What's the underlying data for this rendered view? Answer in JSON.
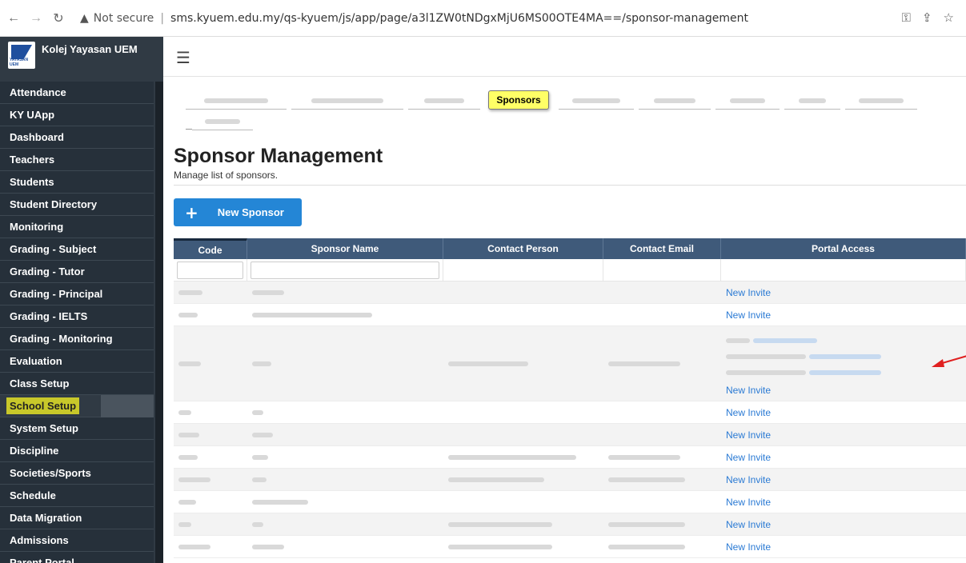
{
  "browser": {
    "security_label": "Not secure",
    "url": "sms.kyuem.edu.my/qs-kyuem/js/app/page/a3l1ZW0tNDgxMjU6MS00OTE4MA==/sponsor-management"
  },
  "sidebar": {
    "brand_name": "Kolej Yayasan UEM",
    "logo_text": "YAYASAN UEM",
    "items": [
      {
        "label": "Attendance"
      },
      {
        "label": "KY UApp"
      },
      {
        "label": "Dashboard"
      },
      {
        "label": "Teachers"
      },
      {
        "label": "Students"
      },
      {
        "label": "Student Directory"
      },
      {
        "label": "Monitoring"
      },
      {
        "label": "Grading - Subject"
      },
      {
        "label": "Grading - Tutor"
      },
      {
        "label": "Grading - Principal"
      },
      {
        "label": "Grading - IELTS"
      },
      {
        "label": "Grading - Monitoring"
      },
      {
        "label": "Evaluation"
      },
      {
        "label": "Class Setup"
      },
      {
        "label": "School Setup",
        "active": true
      },
      {
        "label": "System Setup"
      },
      {
        "label": "Discipline"
      },
      {
        "label": "Societies/Sports"
      },
      {
        "label": "Schedule"
      },
      {
        "label": "Data Migration"
      },
      {
        "label": "Admissions"
      },
      {
        "label": "Parent Portal"
      }
    ]
  },
  "tabs": {
    "active_label": "Sponsors"
  },
  "page": {
    "title": "Sponsor Management",
    "subtitle": "Manage list of sponsors.",
    "new_button_label": "New Sponsor"
  },
  "table": {
    "columns": [
      "Code",
      "Sponsor Name",
      "Contact Person",
      "Contact Email",
      "Portal Access"
    ],
    "invite_label": "New Invite"
  }
}
